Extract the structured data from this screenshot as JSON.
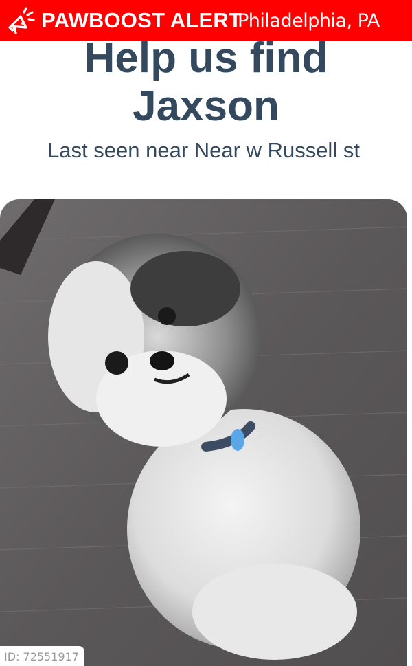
{
  "alert_bar": {
    "brand": "PAWBOOST ALERT",
    "location": "Philadelphia, PA",
    "icon": "megaphone-icon"
  },
  "headline": {
    "line1": "Help us find",
    "line2": "Jaxson"
  },
  "subline": "Last seen near Near w Russell st",
  "photo": {
    "id_label": "ID: 72551917"
  },
  "colors": {
    "alert_red": "#ff0000",
    "heading_text": "#34495e"
  }
}
